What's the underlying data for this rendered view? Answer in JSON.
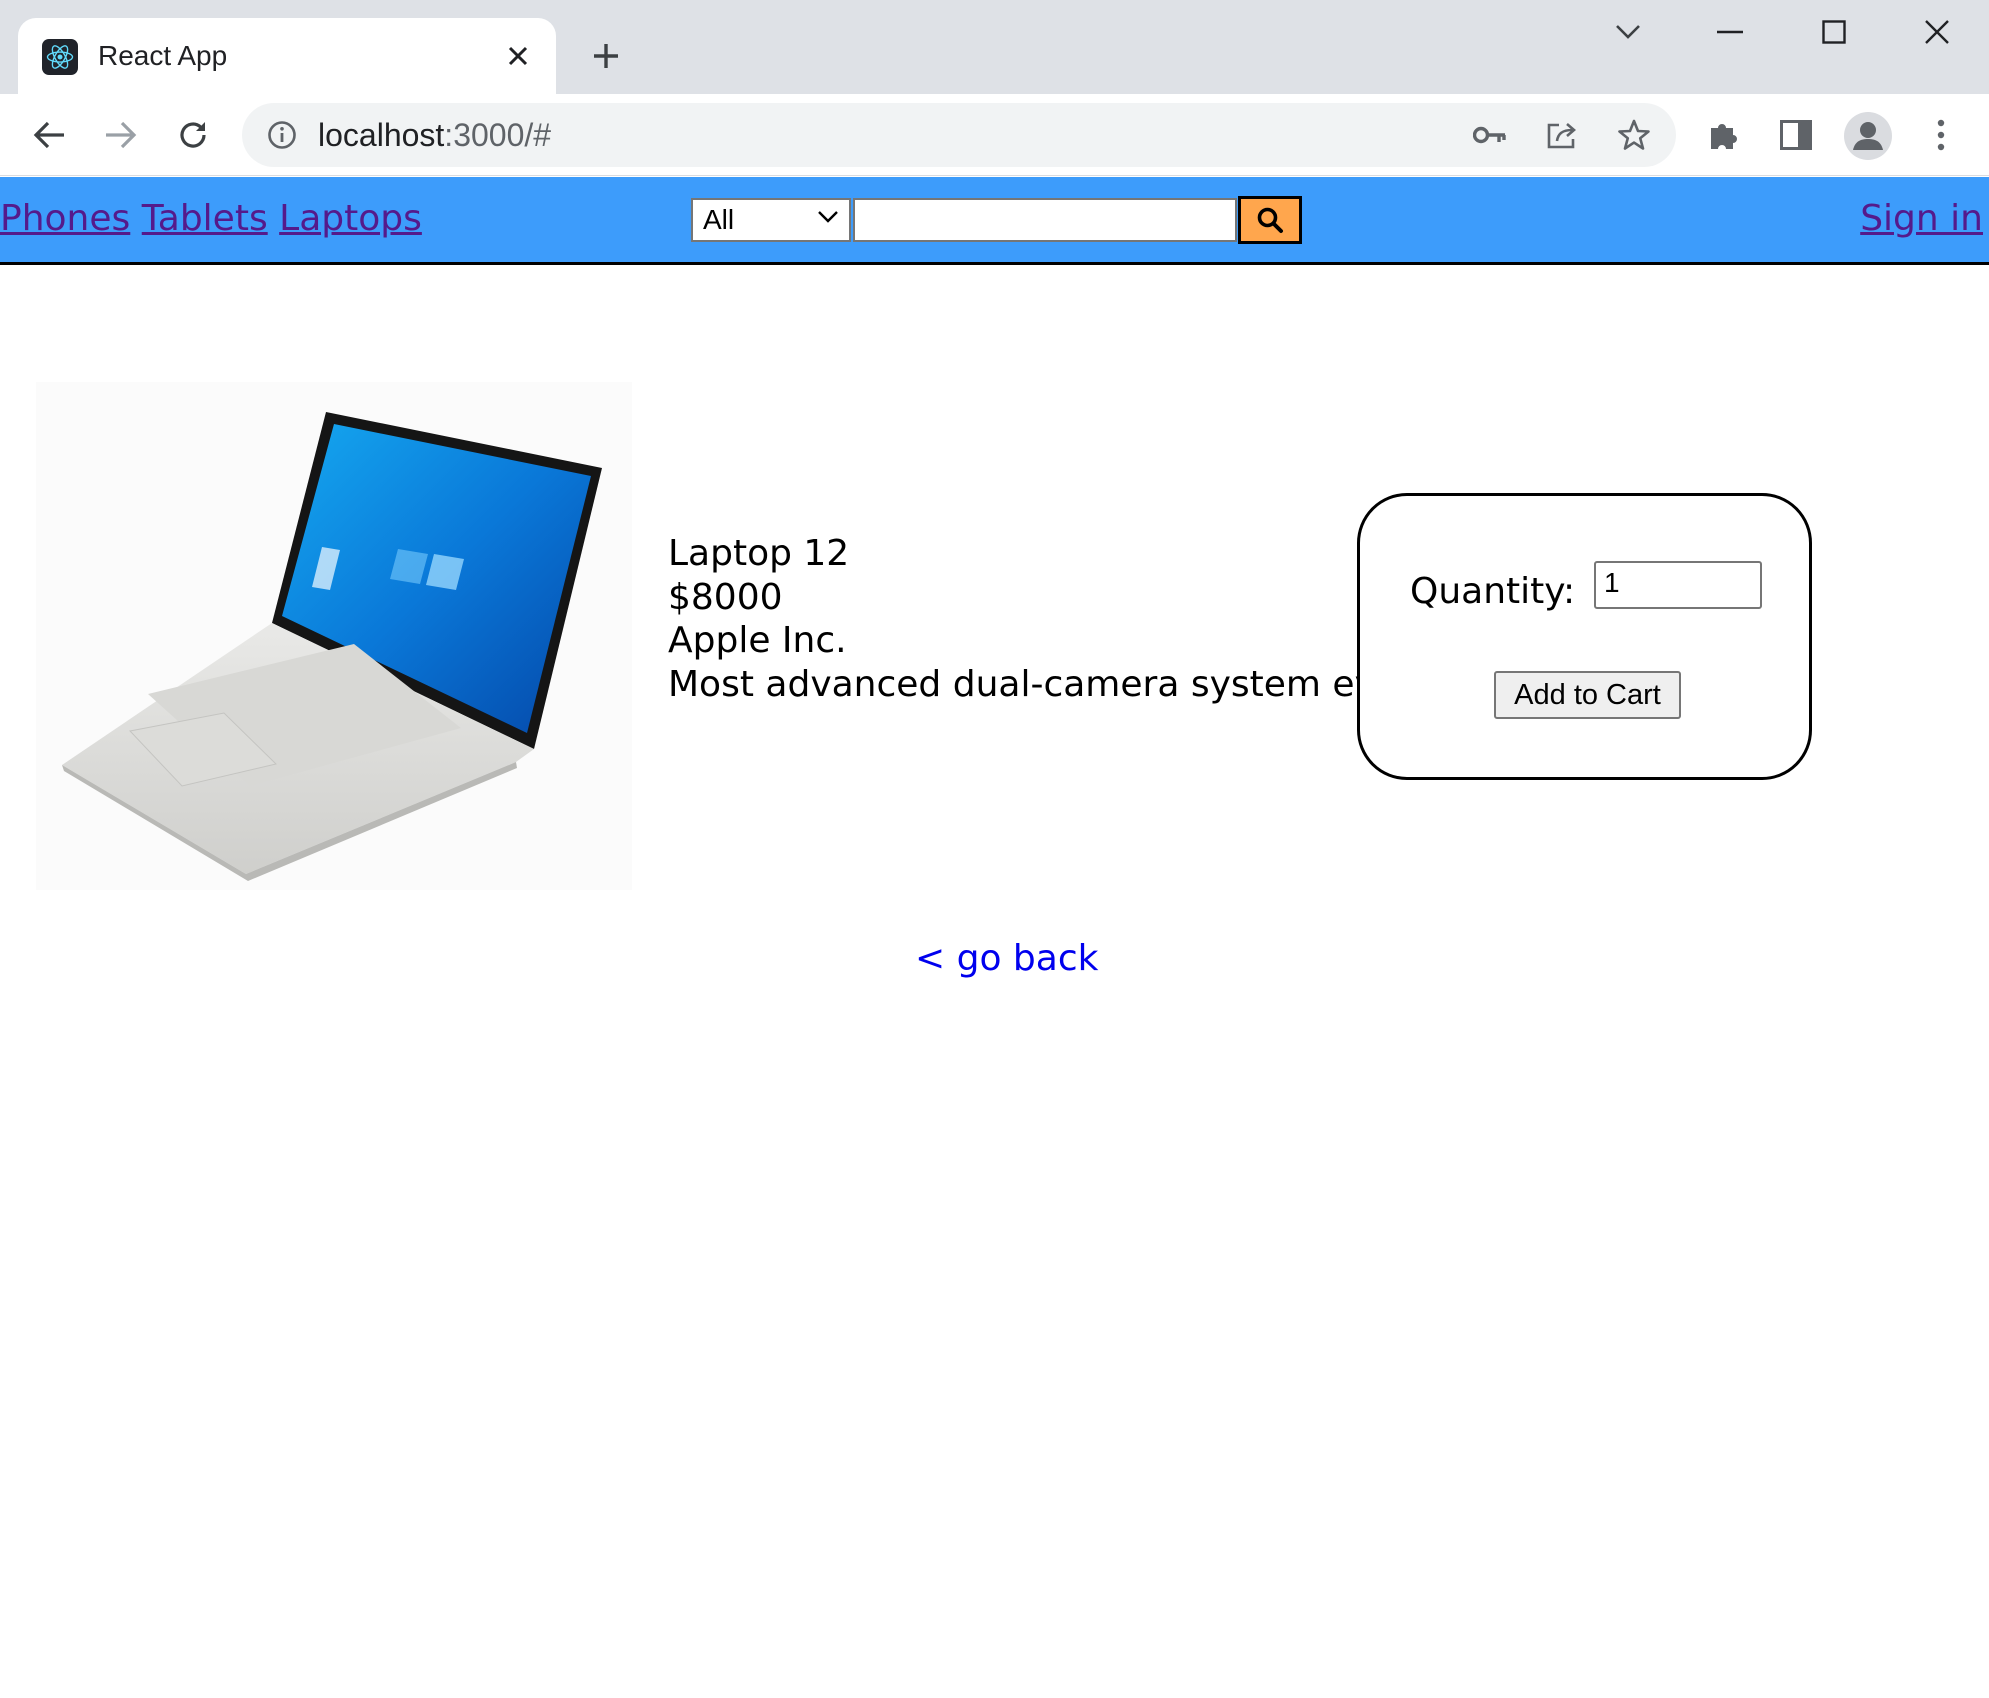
{
  "browser": {
    "tab_title": "React App",
    "url_host": "localhost",
    "url_path": ":3000/#"
  },
  "navbar": {
    "links": [
      "Phones",
      "Tablets",
      "Laptops"
    ],
    "category_selected": "All",
    "search_value": "",
    "signin_label": "Sign in",
    "colors": {
      "bar": "#3d9cfb",
      "search_button": "#ffa64d",
      "link": "#551a8b"
    }
  },
  "product": {
    "name": "Laptop 12",
    "price": "$8000",
    "manufacturer": "Apple Inc.",
    "description": "Most advanced dual-camera system ever."
  },
  "cart": {
    "quantity_label": "Quantity:",
    "quantity_value": "1",
    "add_button": "Add to Cart"
  },
  "go_back_label": "< go back"
}
